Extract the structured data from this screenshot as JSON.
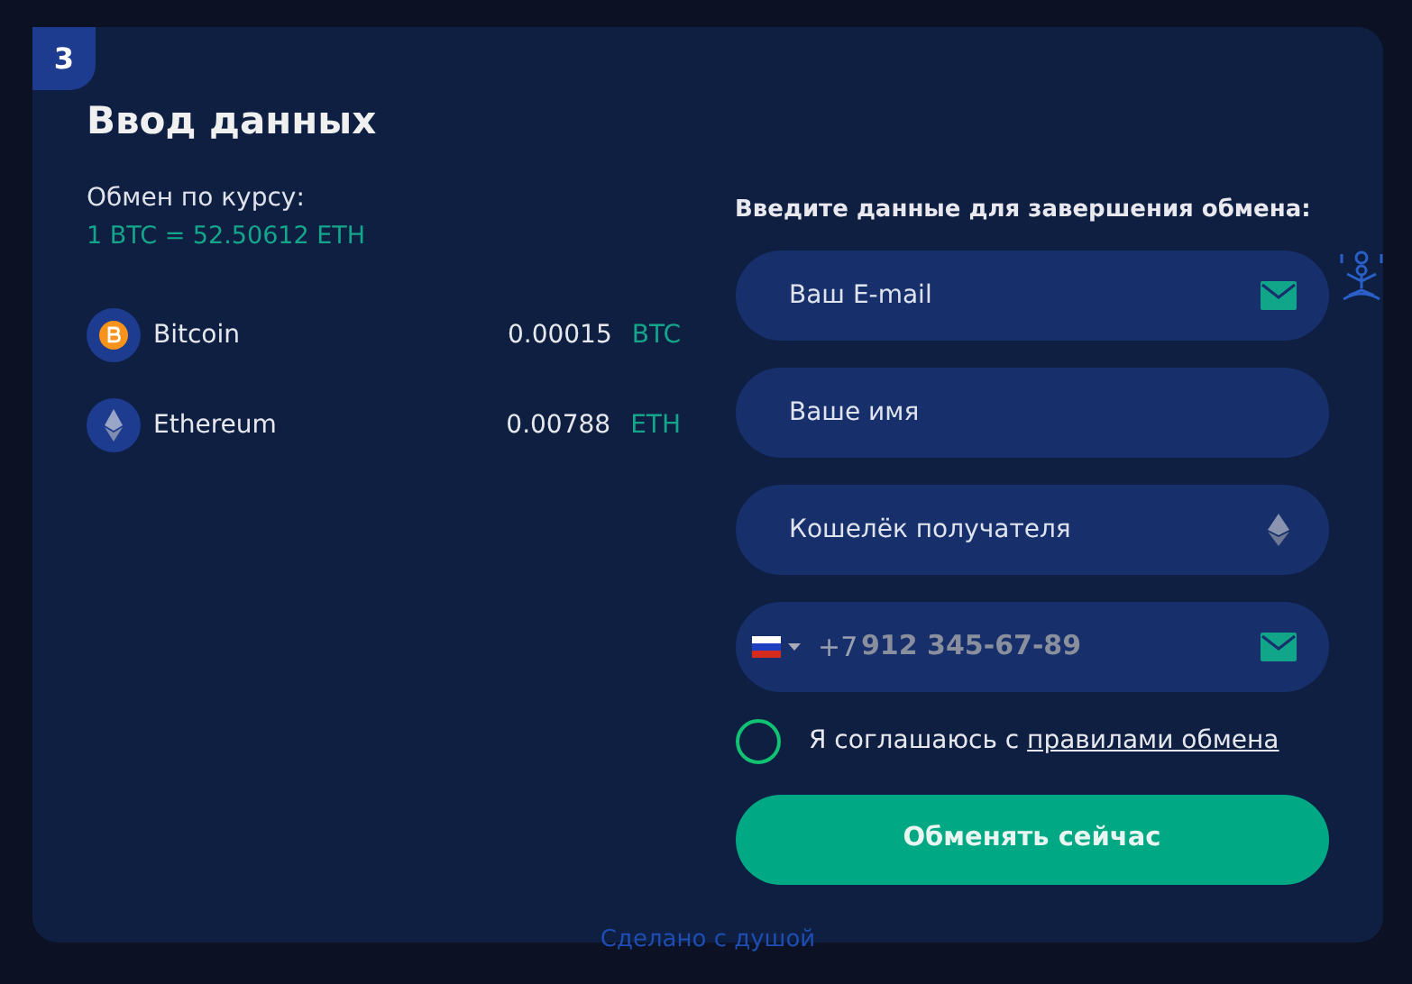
{
  "step": "3",
  "title": "Ввод данных",
  "rate": {
    "label": "Обмен по курсу:",
    "value": "1 BTC = 52.50612 ETH"
  },
  "currencies": [
    {
      "kind": "btc",
      "name": "Bitcoin",
      "amount": "0.00015",
      "unit": "BTC"
    },
    {
      "kind": "eth",
      "name": "Ethereum",
      "amount": "0.00788",
      "unit": "ETH"
    }
  ],
  "form": {
    "heading": "Введите данные для завершения обмена:",
    "fields": [
      {
        "kind": "email",
        "placeholder": "Ваш E-mail"
      },
      {
        "kind": "text",
        "placeholder": "Ваше имя"
      },
      {
        "kind": "wallet",
        "placeholder": "Кошелёк получателя"
      },
      {
        "kind": "phone",
        "prefix": "+7",
        "placeholder": "912 345-67-89"
      }
    ],
    "agree": {
      "checked": false,
      "text": "Я соглашаюсь с",
      "link": "правилами обмена"
    },
    "submit": "Обменять сейчас"
  },
  "footer": "Сделано с душой"
}
